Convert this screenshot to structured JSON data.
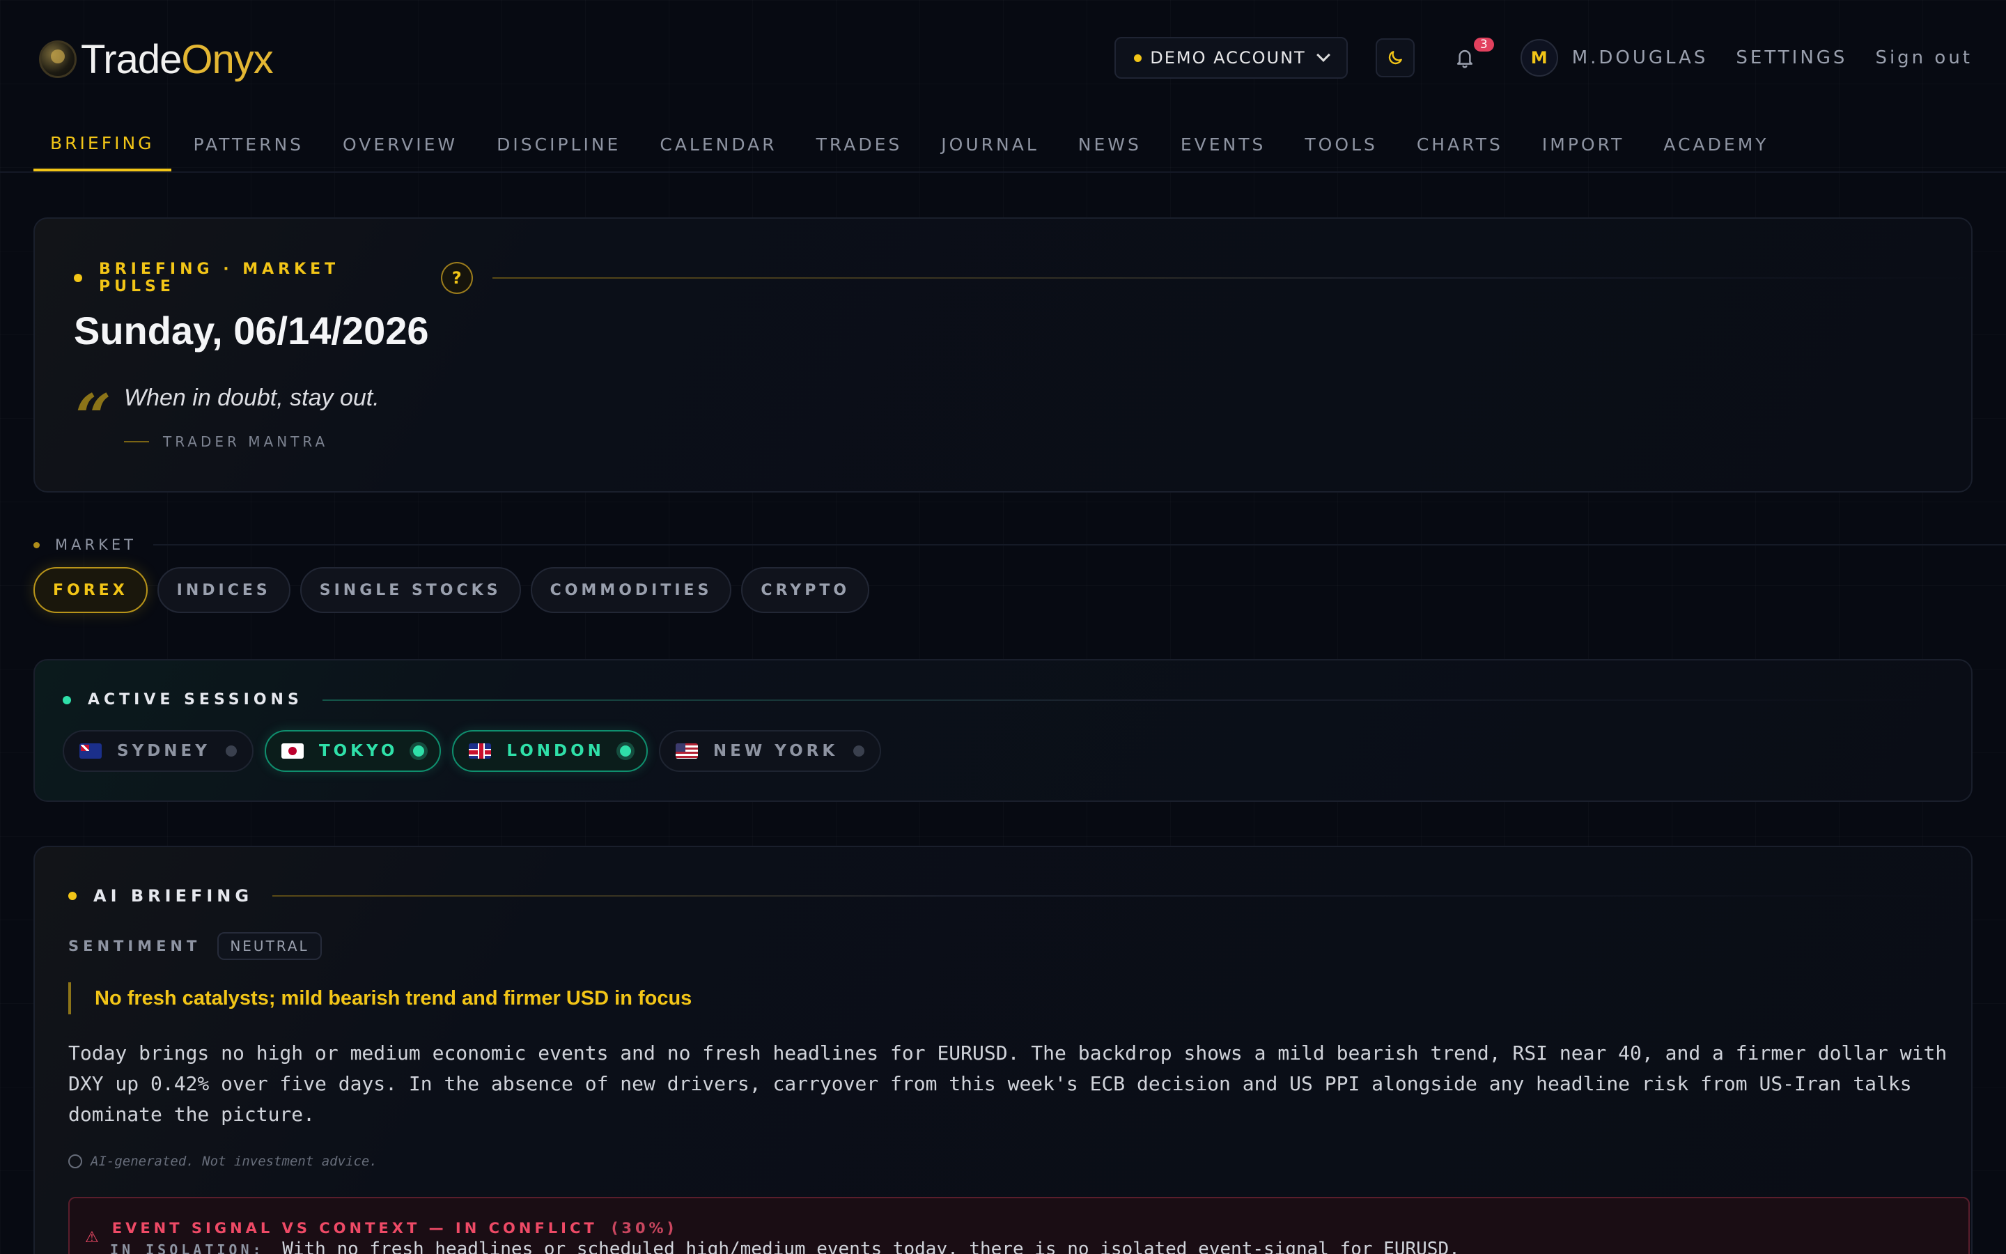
{
  "brand": {
    "part1": "Trade",
    "part2": "Onyx"
  },
  "account": {
    "label": "DEMO ACCOUNT"
  },
  "notifications": {
    "count": "3"
  },
  "user": {
    "initial": "M",
    "name": "M.DOUGLAS"
  },
  "header": {
    "settings": "SETTINGS",
    "signout": "Sign out"
  },
  "nav": {
    "items": [
      {
        "label": "BRIEFING"
      },
      {
        "label": "PATTERNS"
      },
      {
        "label": "OVERVIEW"
      },
      {
        "label": "DISCIPLINE"
      },
      {
        "label": "CALENDAR"
      },
      {
        "label": "TRADES"
      },
      {
        "label": "JOURNAL"
      },
      {
        "label": "NEWS"
      },
      {
        "label": "EVENTS"
      },
      {
        "label": "TOOLS"
      },
      {
        "label": "CHARTS"
      },
      {
        "label": "IMPORT"
      },
      {
        "label": "ACADEMY"
      }
    ]
  },
  "pulse": {
    "section": "BRIEFING · MARKET PULSE",
    "help": "?",
    "date": "Sunday, 06/14/2026",
    "quote_mark": "“",
    "quote": "When in doubt, stay out.",
    "attribution": "TRADER MANTRA"
  },
  "market": {
    "label": "MARKET",
    "chips": [
      {
        "label": "FOREX"
      },
      {
        "label": "INDICES"
      },
      {
        "label": "SINGLE STOCKS"
      },
      {
        "label": "COMMODITIES"
      },
      {
        "label": "CRYPTO"
      }
    ]
  },
  "sessions": {
    "title": "ACTIVE SESSIONS",
    "items": [
      {
        "label": "SYDNEY",
        "active": false
      },
      {
        "label": "TOKYO",
        "active": true
      },
      {
        "label": "LONDON",
        "active": true
      },
      {
        "label": "NEW YORK",
        "active": false
      }
    ]
  },
  "ai": {
    "title": "AI BRIEFING",
    "sentiment_label": "SENTIMENT",
    "sentiment_value": "NEUTRAL",
    "headline": "No fresh catalysts; mild bearish trend and firmer USD in focus",
    "body": "Today brings no high or medium economic events and no fresh headlines for EURUSD. The backdrop shows a mild bearish trend, RSI near 40, and a firmer dollar with DXY up 0.42% over five days. In the absence of new drivers, carryover from this week's ECB decision and US PPI alongside any headline risk from US-Iran talks dominate the picture.",
    "disclaimer": "AI-generated. Not investment advice.",
    "conflict": {
      "title": "EVENT SIGNAL VS CONTEXT — IN CONFLICT",
      "percent": "(30%)",
      "key": "IN ISOLATION:",
      "text": "With no fresh headlines or scheduled high/medium events today, there is no isolated event-signal for EURUSD."
    }
  },
  "colors": {
    "accent": "#f2c517",
    "session_on": "#2fe0a9",
    "conflict": "#ee4a66"
  }
}
